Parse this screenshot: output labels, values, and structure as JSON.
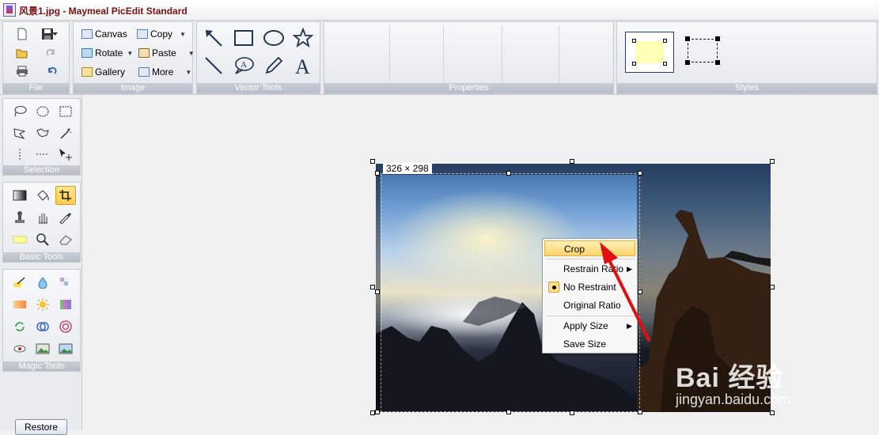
{
  "titlebar": {
    "title": "风景1.jpg - Maymeal PicEdit Standard"
  },
  "ribbon": {
    "groups": {
      "file": "File",
      "image": "Image",
      "vector": "Vector Tools",
      "properties": "Properties",
      "styles": "Styles"
    },
    "image_buttons": {
      "canvas": "Canvas",
      "copy": "Copy",
      "rotate": "Rotate",
      "paste": "Paste",
      "gallery": "Gallery",
      "more": "More"
    }
  },
  "left_panel": {
    "groups": {
      "selection": "Selection",
      "basic": "Basic Tools",
      "magic": "Magic Tools"
    },
    "restore": "Restore"
  },
  "canvas": {
    "size_label": "326 × 298"
  },
  "context_menu": {
    "crop": "Crop",
    "restrain_ratio": "Restrain Ratio",
    "no_restraint": "No Restraint",
    "original_ratio": "Original Ratio",
    "apply_size": "Apply Size",
    "save_size": "Save Size"
  },
  "watermark": {
    "main": "Bai 经验",
    "url": "jingyan.baidu.com"
  },
  "colors": {
    "accent_highlight": "#ffd36a",
    "annotation_red": "#e01010",
    "style_fill": "#ffffb8"
  }
}
